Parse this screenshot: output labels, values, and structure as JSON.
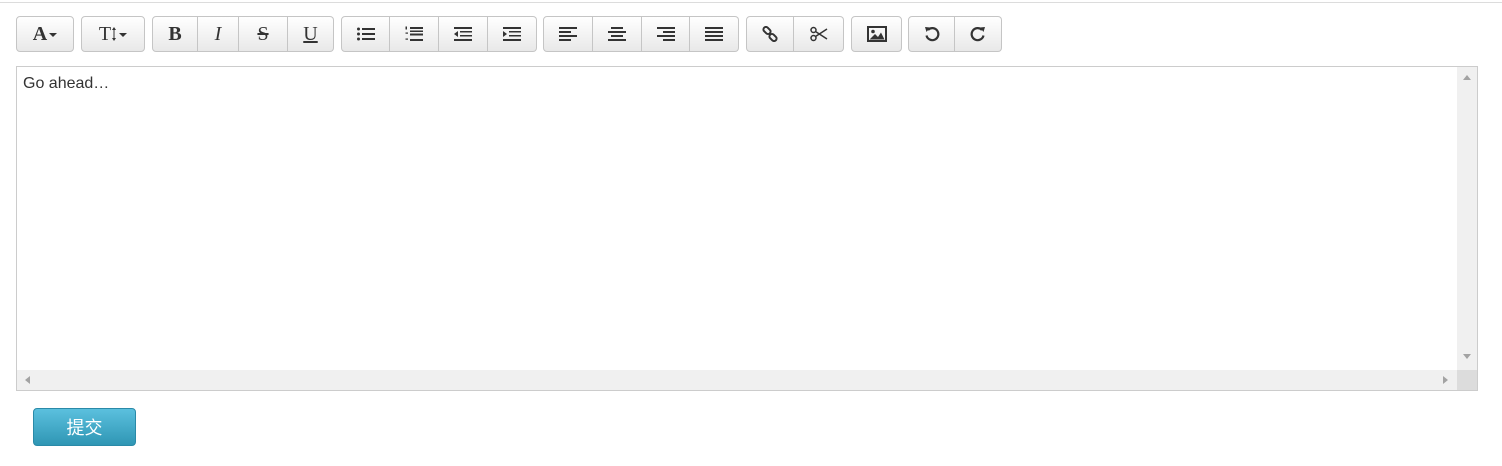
{
  "toolbar": {
    "font_button_label": "A",
    "font_size_button_label": "T",
    "bold_label": "B",
    "italic_label": "I",
    "strikethrough_label": "S",
    "underline_label": "U",
    "icons": [
      "font-icon",
      "font-size-icon",
      "bold-icon",
      "italic-icon",
      "strikethrough-icon",
      "underline-icon",
      "bullet-list-icon",
      "numbered-list-icon",
      "outdent-icon",
      "indent-icon",
      "align-left-icon",
      "align-center-icon",
      "align-right-icon",
      "align-justify-icon",
      "link-icon",
      "unlink-icon",
      "image-icon",
      "undo-icon",
      "redo-icon"
    ]
  },
  "editor": {
    "content": "Go ahead…"
  },
  "form": {
    "submit_label": "提交"
  },
  "colors": {
    "submit_background": "#49afcd",
    "toolbar_border": "#c5c5c5"
  }
}
